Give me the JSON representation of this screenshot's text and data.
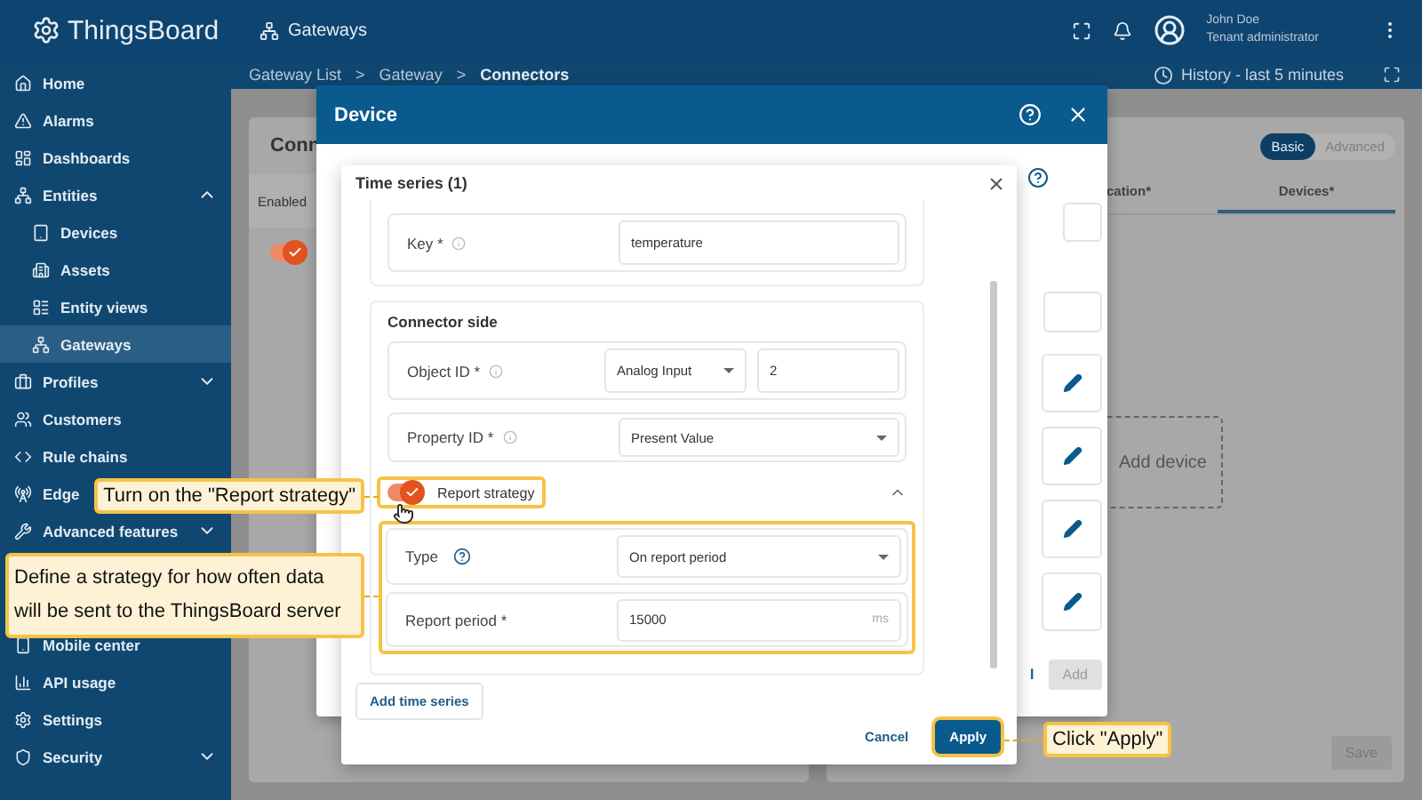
{
  "top_bar": {
    "logo": "ThingsBoard",
    "section": "Gateways",
    "user_name": "John Doe",
    "user_role": "Tenant administrator"
  },
  "sidebar": {
    "groups": [
      {
        "items": [
          {
            "label": "Home",
            "selected": false
          },
          {
            "label": "Alarms",
            "selected": false
          },
          {
            "label": "Dashboards",
            "selected": false
          },
          {
            "label": "Entities",
            "selected": false,
            "expanded": true,
            "children": [
              {
                "label": "Devices",
                "selected": false
              },
              {
                "label": "Assets",
                "selected": false
              },
              {
                "label": "Entity views",
                "selected": false
              },
              {
                "label": "Gateways",
                "selected": true
              }
            ]
          },
          {
            "label": "Profiles",
            "selected": false,
            "expanded": false
          },
          {
            "label": "Customers",
            "selected": false
          },
          {
            "label": "Rule chains",
            "selected": false
          },
          {
            "label": "Edge",
            "selected": false
          },
          {
            "label": "Advanced features",
            "selected": false,
            "expanded": false
          }
        ]
      },
      {
        "items": [
          {
            "label": "Mobile center",
            "selected": false
          },
          {
            "label": "API usage",
            "selected": false
          },
          {
            "label": "Settings",
            "selected": false
          },
          {
            "label": "Security",
            "selected": false,
            "expanded": false
          }
        ]
      }
    ]
  },
  "breadcrumbs": {
    "separator": ">",
    "items": [
      {
        "label": "Gateway List",
        "selected": false
      },
      {
        "label": "Gateway",
        "selected": false
      },
      {
        "label": "Connectors",
        "selected": true
      }
    ]
  },
  "history": "History - last 5 minutes",
  "connectors_panel": {
    "title": "Conn",
    "column": "Enabled",
    "rows": [
      {
        "enabled": true
      }
    ]
  },
  "config_panel": {
    "modes": [
      {
        "label": "Basic",
        "selected": true
      },
      {
        "label": "Advanced",
        "selected": false
      }
    ],
    "tabs": [
      {
        "label": "cation*",
        "selected": false
      },
      {
        "label": "Devices*",
        "selected": true
      }
    ],
    "add_device": "Add device",
    "save": "Save"
  },
  "device_dialog": {
    "title": "Device",
    "cancel": "l",
    "add": "Add"
  },
  "time_series_dialog": {
    "title": "Time series (1)",
    "key": {
      "label": "Key *",
      "value": "temperature"
    },
    "connector_side": {
      "title": "Connector side",
      "object_id": {
        "label": "Object ID *",
        "type": "Analog Input",
        "value": "2"
      },
      "property_id": {
        "label": "Property ID *",
        "value": "Present Value"
      }
    },
    "report_strategy": {
      "label": "Report strategy",
      "on": true,
      "expanded": true,
      "type": {
        "label": "Type",
        "value": "On report period"
      },
      "report_period": {
        "label": "Report period *",
        "value": "15000",
        "unit": "ms"
      }
    },
    "add_button": "Add time series",
    "cancel": "Cancel",
    "apply": "Apply"
  },
  "callouts": [
    {
      "text": "Turn on the \"Report strategy\""
    },
    {
      "text": "Define a strategy for how often data will be sent to the ThingsBoard server"
    },
    {
      "text": "Click \"Apply\""
    }
  ]
}
